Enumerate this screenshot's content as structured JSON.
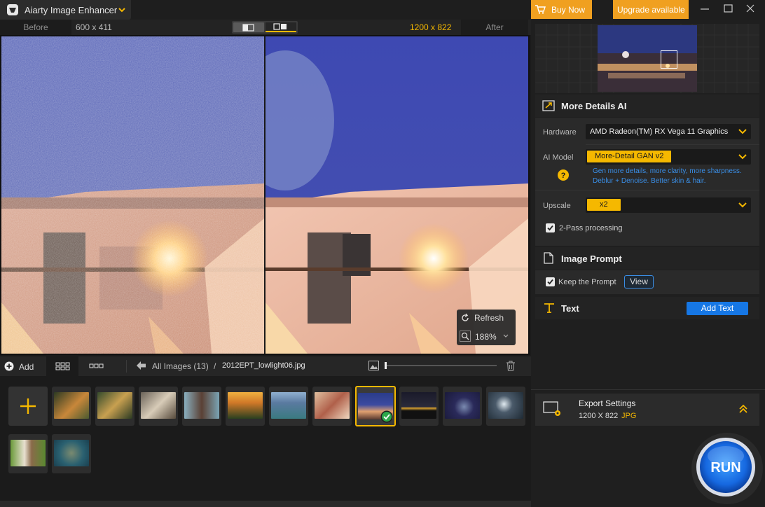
{
  "titlebar": {
    "app_title": "Aiarty Image Enhancer",
    "buy_now": "Buy Now",
    "upgrade": "Upgrade available"
  },
  "compare": {
    "before_label": "Before",
    "before_size": "600 x 411",
    "after_size": "1200 x 822",
    "after_label": "After"
  },
  "zoom_popup": {
    "refresh": "Refresh",
    "zoom": "188%"
  },
  "thumbbar": {
    "add": "Add",
    "breadcrumb_root": "All Images (13)",
    "breadcrumb_sep": "/",
    "breadcrumb_file": "2012EPT_lowlight06.jpg"
  },
  "panel": {
    "more_details_title": "More Details AI",
    "hardware_label": "Hardware",
    "hardware_value": "AMD Radeon(TM) RX Vega 11 Graphics",
    "ai_model_label": "AI Model",
    "ai_model_value": "More-Detail GAN v2",
    "ai_model_desc_1": "Gen more details, more clarity, more sharpness.",
    "ai_model_desc_2": "Deblur + Denoise. Better skin & hair.",
    "upscale_label": "Upscale",
    "upscale_value": "x2",
    "two_pass": "2-Pass processing",
    "image_prompt_title": "Image Prompt",
    "keep_prompt": "Keep the Prompt",
    "view": "View",
    "text_title": "Text",
    "add_text": "Add Text",
    "export_title": "Export Settings",
    "export_size": "1200 X 822",
    "export_format": "JPG",
    "run": "RUN"
  },
  "colors": {
    "accent": "#f5b800",
    "orange": "#f0a020",
    "blue_btn": "#1677e5",
    "link_blue": "#3a8ee6"
  }
}
